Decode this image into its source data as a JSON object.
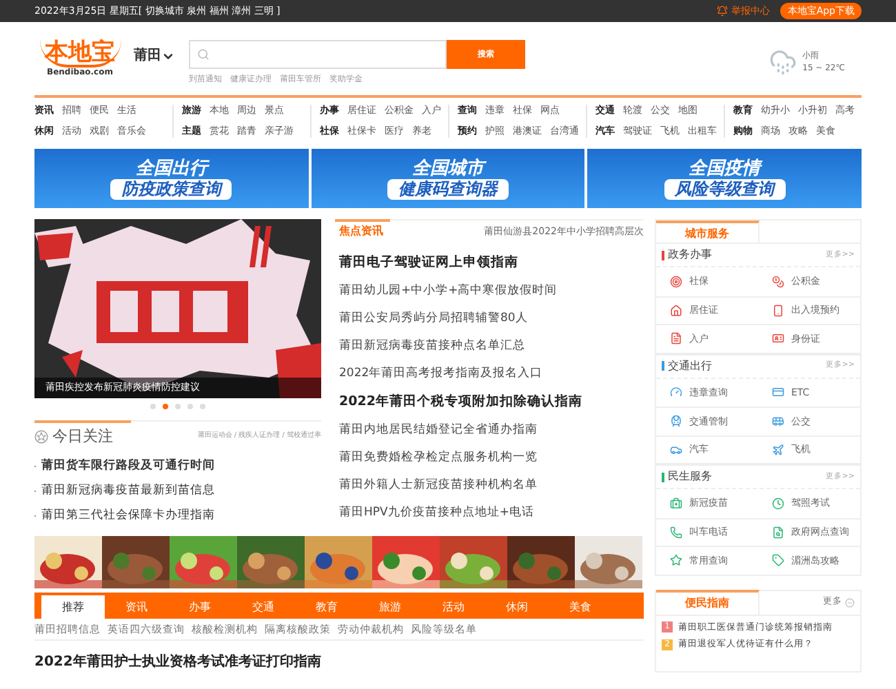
{
  "top_bar": {
    "date_text": "2022年3月25日 星期五[ 切换城市 泉州 福州 漳州 三明 ]",
    "report_link": "举报中心",
    "app_button": "本地宝App下载"
  },
  "header": {
    "logo": "本地宝",
    "logo_sub": "Bendibao.com",
    "city": "莆田",
    "search_button": "搜索",
    "hot_words": [
      "到苗通知",
      "健康证办理",
      "莆田车管所",
      "奖助学金"
    ],
    "weather": {
      "condition": "小雨",
      "temp": "15 ~ 22℃"
    }
  },
  "nav_groups": [
    {
      "rows": [
        {
          "label": "资讯",
          "links": [
            "招聘",
            "便民",
            "生活"
          ]
        },
        {
          "label": "休闲",
          "links": [
            "活动",
            "戏剧",
            "音乐会"
          ]
        }
      ]
    },
    {
      "rows": [
        {
          "label": "旅游",
          "links": [
            "本地",
            "周边",
            "景点"
          ]
        },
        {
          "label": "主题",
          "links": [
            "赏花",
            "踏青",
            "亲子游"
          ]
        }
      ]
    },
    {
      "rows": [
        {
          "label": "办事",
          "links": [
            "居住证",
            "公积金",
            "入户"
          ]
        },
        {
          "label": "社保",
          "links": [
            "社保卡",
            "医疗",
            "养老"
          ]
        }
      ]
    },
    {
      "rows": [
        {
          "label": "查询",
          "links": [
            "违章",
            "社保",
            "网点"
          ]
        },
        {
          "label": "预约",
          "links": [
            "护照",
            "港澳证",
            "台湾通"
          ]
        }
      ]
    },
    {
      "rows": [
        {
          "label": "交通",
          "links": [
            "轮渡",
            "公交",
            "地图"
          ]
        },
        {
          "label": "汽车",
          "links": [
            "驾驶证",
            "飞机",
            "出租车"
          ]
        }
      ]
    },
    {
      "rows": [
        {
          "label": "教育",
          "links": [
            "幼升小",
            "小升初",
            "高考"
          ]
        },
        {
          "label": "购物",
          "links": [
            "商场",
            "攻略",
            "美食"
          ]
        }
      ]
    }
  ],
  "banners": [
    {
      "line1": "全国出行",
      "line2": "防疫政策查询"
    },
    {
      "line1": "全国城市",
      "line2": "健康码查询器"
    },
    {
      "line1": "全国疫情",
      "line2": "风险等级查询"
    }
  ],
  "carousel": {
    "kind": "picture",
    "caption": "莆田疾控发布新冠肺炎疫情防控建议",
    "dots": [
      {
        "selected": false
      },
      {
        "selected": true
      },
      {
        "selected": false
      },
      {
        "selected": false
      },
      {
        "selected": false
      }
    ]
  },
  "today": {
    "title": "今日关注",
    "tags": "莆田运动会 / 残疾人证办理 / 驾校通过率",
    "items": [
      {
        "text": "莆田货车限行路段及可通行时间",
        "bold": true
      },
      {
        "text": "莆田新冠病毒疫苗最新到苗信息",
        "bold": false
      },
      {
        "text": "莆田第三代社会保障卡办理指南",
        "bold": false
      }
    ]
  },
  "focus": {
    "tab": "焦点资讯",
    "ticker": "莆田仙游县2022年中小学招聘高层次",
    "news": [
      {
        "text": "莆田电子驾驶证网上申领指南",
        "kind": "headline"
      },
      {
        "text": "莆田幼儿园+中小学+高中寒假放假时间",
        "kind": "item"
      },
      {
        "text": "莆田公安局秀屿分局招聘辅警80人",
        "kind": "item"
      },
      {
        "text": "莆田新冠病毒疫苗接种点名单汇总",
        "kind": "item"
      },
      {
        "text": "2022年莆田高考报考指南及报名入口",
        "kind": "item"
      },
      {
        "text": "2022年莆田个税专项附加扣除确认指南",
        "kind": "headline"
      },
      {
        "text": "莆田内地居民结婚登记全省通办指南",
        "kind": "item"
      },
      {
        "text": "莆田免费婚检孕检定点服务机构一览",
        "kind": "item"
      },
      {
        "text": "莆田外籍人士新冠疫苗接种机构名单",
        "kind": "item"
      },
      {
        "text": "莆田HPV九价疫苗接种点地址+电话",
        "kind": "item"
      }
    ]
  },
  "category_tabs": [
    {
      "label": "推荐",
      "selected": true
    },
    {
      "label": "资讯",
      "selected": false
    },
    {
      "label": "办事",
      "selected": false
    },
    {
      "label": "交通",
      "selected": false
    },
    {
      "label": "教育",
      "selected": false
    },
    {
      "label": "旅游",
      "selected": false
    },
    {
      "label": "活动",
      "selected": false
    },
    {
      "label": "休闲",
      "selected": false
    },
    {
      "label": "美食",
      "selected": false
    }
  ],
  "quick_links": [
    "莆田招聘信息",
    "英语四六级查询",
    "核酸检测机构",
    "隔离核酸政策",
    "劳动仲裁机构",
    "风险等级名单"
  ],
  "bottom_headline": "2022年莆田护士执业资格考试准考证打印指南",
  "city_services": {
    "tab": "城市服务",
    "sections": [
      {
        "title": "政务办事",
        "color": "#e8453c",
        "more": "更多>>",
        "items": [
          "社保",
          "公积金",
          "居住证",
          "出入境预约",
          "入户",
          "身份证"
        ]
      },
      {
        "title": "交通出行",
        "color": "#3a9be0",
        "more": "更多>>",
        "items": [
          "违章查询",
          "ETC",
          "交通管制",
          "公交",
          "汽车",
          "飞机"
        ]
      },
      {
        "title": "民生服务",
        "color": "#2bb673",
        "more": "更多>>",
        "items": [
          "新冠疫苗",
          "驾照考试",
          "叫车电话",
          "政府网点查询",
          "常用查询",
          "湄洲岛攻略"
        ]
      }
    ]
  },
  "guide": {
    "tab": "便民指南",
    "more": "更多",
    "items": [
      {
        "num": "1",
        "text": "莆田职工医保普通门诊统筹报销指南",
        "color": "#f08080"
      },
      {
        "num": "2",
        "text": "莆田退役军人优待证有什么用？",
        "color": "#f5b942"
      }
    ]
  }
}
